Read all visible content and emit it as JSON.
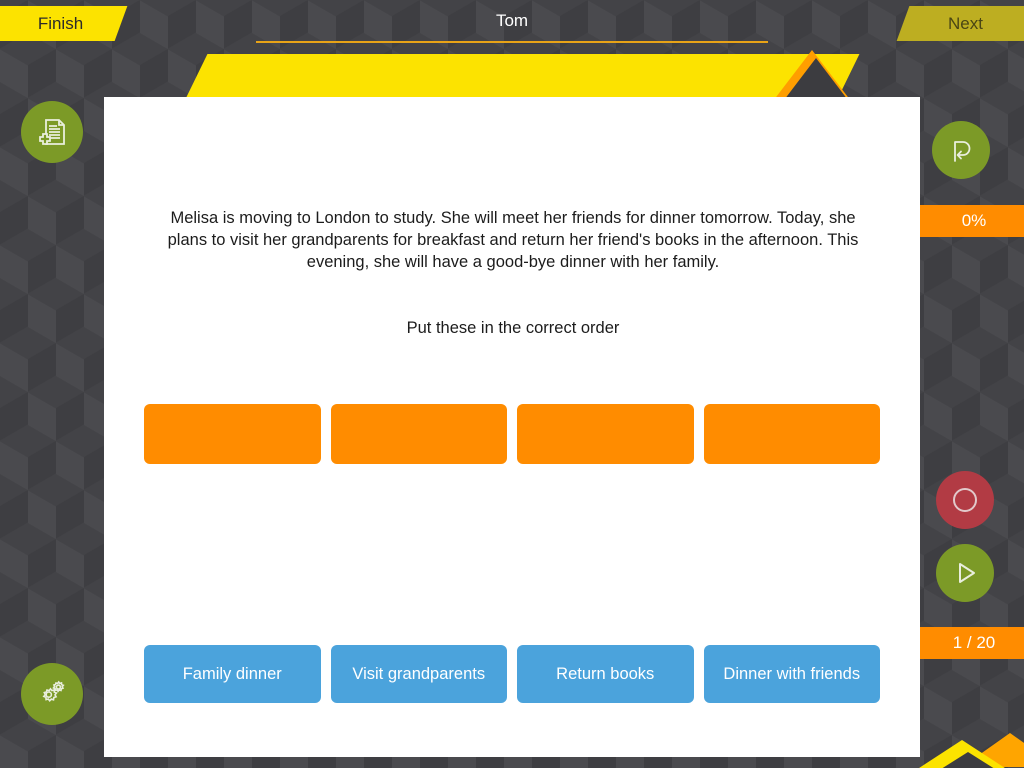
{
  "header": {
    "finish_label": "Finish",
    "next_label": "Next",
    "title": "Tom"
  },
  "sidebar_left": [
    {
      "name": "add-note-button",
      "icon": "document-plus-icon"
    },
    {
      "name": "settings-button",
      "icon": "gears-icon"
    }
  ],
  "sidebar_right": [
    {
      "name": "replay-button",
      "icon": "replay-loop-icon"
    },
    {
      "name": "record-button",
      "icon": "record-circle-icon"
    },
    {
      "name": "play-button",
      "icon": "play-triangle-icon"
    }
  ],
  "badges": {
    "progress": "0%",
    "counter": "1 / 20"
  },
  "main": {
    "question": "Melisa is moving to London to study. She will meet her friends for dinner tomorrow. Today, she plans to visit her grandparents for breakfast and return her friend's books in the afternoon. This evening, she will have a good-bye dinner with her family.",
    "instruction": "Put these in the correct order",
    "slots": [
      {
        "label": "",
        "filled": false
      },
      {
        "label": "",
        "filled": false
      },
      {
        "label": "",
        "filled": false
      },
      {
        "label": "",
        "filled": false
      }
    ],
    "tiles": [
      {
        "label": "Family dinner"
      },
      {
        "label": "Visit grandparents"
      },
      {
        "label": "Return books"
      },
      {
        "label": "Dinner with friends"
      }
    ]
  },
  "colors": {
    "accent_yellow": "#FCE300",
    "accent_orange": "#FF8C00",
    "tile_blue": "#4BA3DC",
    "button_green": "#7C9A27",
    "button_red": "#B23B44",
    "background_dark": "#3e3e42"
  }
}
